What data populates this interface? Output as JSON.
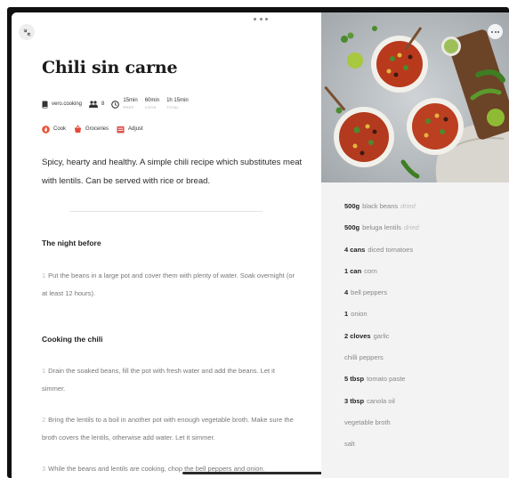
{
  "recipe": {
    "title": "Chili sin carne",
    "source": "vero.cooking",
    "servings": "8",
    "times": [
      {
        "value": "15min",
        "label": "PREP"
      },
      {
        "value": "60min",
        "label": "COOK"
      },
      {
        "value": "1h 15min",
        "label": "TOTAL"
      }
    ],
    "actions": {
      "cook": "Cook",
      "groceries": "Groceries",
      "adjust": "Adjust"
    },
    "description": "Spicy, hearty and healthy. A simple chili recipe which substitutes meat with lentils. Can be served with rice or bread.",
    "sections": [
      {
        "title": "The night before",
        "steps": [
          {
            "num": "1",
            "text": "Put the beans in a large pot and cover them with plenty of water. Soak overnight (or at least 12 hours)."
          }
        ]
      },
      {
        "title": "Cooking the chili",
        "steps": [
          {
            "num": "1",
            "text": "Drain the soaked beans, fill the pot with fresh water and add the beans. Let it simmer."
          },
          {
            "num": "2",
            "text": "Bring the lentils to a boil in another pot with enough vegetable broth. Make sure the broth covers the lentils, otherwise add water. Let it simmer."
          },
          {
            "num": "3",
            "text": "While the beans and lentils are cooking, chop the bell peppers and onion."
          }
        ]
      }
    ]
  },
  "ingredients": [
    {
      "qty": "500g",
      "name": "black beans",
      "note": "dried"
    },
    {
      "qty": "500g",
      "name": "beluga lentils",
      "note": "dried"
    },
    {
      "qty": "4 cans",
      "name": "diced tomatoes",
      "note": ""
    },
    {
      "qty": "1 can",
      "name": "corn",
      "note": ""
    },
    {
      "qty": "4",
      "name": "bell peppers",
      "note": ""
    },
    {
      "qty": "1",
      "name": "onion",
      "note": ""
    },
    {
      "qty": "2 cloves",
      "name": "garlic",
      "note": ""
    },
    {
      "qty": "",
      "name": "chilli peppers",
      "note": ""
    },
    {
      "qty": "5 tbsp",
      "name": "tomato paste",
      "note": ""
    },
    {
      "qty": "3 tbsp",
      "name": "canola oil",
      "note": ""
    },
    {
      "qty": "",
      "name": "vegetable broth",
      "note": ""
    },
    {
      "qty": "",
      "name": "salt",
      "note": ""
    }
  ],
  "icons": {
    "close": "collapse-arrows-icon",
    "more": "more-horizontal-icon",
    "source": "book-icon",
    "servings": "people-icon",
    "time": "clock-icon",
    "cook": "flame-icon",
    "groceries": "basket-icon",
    "adjust": "scale-icon"
  },
  "colors": {
    "cook_icon": "#e8553a",
    "groceries_icon": "#e04a3a",
    "adjust_icon": "#d9534f",
    "right_panel_bg": "#f3f3f3"
  }
}
